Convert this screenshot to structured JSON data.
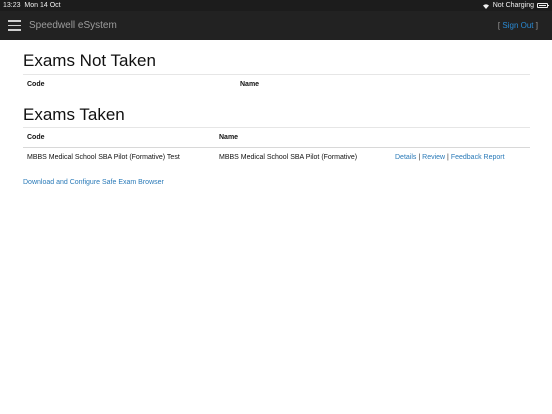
{
  "status_bar": {
    "time": "13:23",
    "date": "Mon 14 Oct",
    "charging": "Not Charging",
    "icons": [
      "wifi-icon",
      "battery-icon"
    ]
  },
  "navbar": {
    "brand": "Speedwell eSystem",
    "signout_open": "[",
    "signout_label": "Sign Out",
    "signout_close": "]",
    "menu_icon": "hamburger-icon"
  },
  "not_taken": {
    "title": "Exams Not Taken",
    "headers": {
      "code": "Code",
      "name": "Name"
    }
  },
  "taken": {
    "title": "Exams Taken",
    "headers": {
      "code": "Code",
      "name": "Name"
    },
    "rows": [
      {
        "code": "MBBS Medical School SBA Pilot (Formative) Test",
        "name": "MBBS Medical School SBA Pilot (Formative)",
        "details": "Details",
        "review": "Review",
        "feedback": "Feedback Report",
        "separator": "|"
      }
    ]
  },
  "download_link": "Download and Configure Safe Exam Browser",
  "colors": {
    "navbar_bg": "#222222",
    "link": "#2a7ab8",
    "status_bar_bg": "#1c1c1c"
  }
}
